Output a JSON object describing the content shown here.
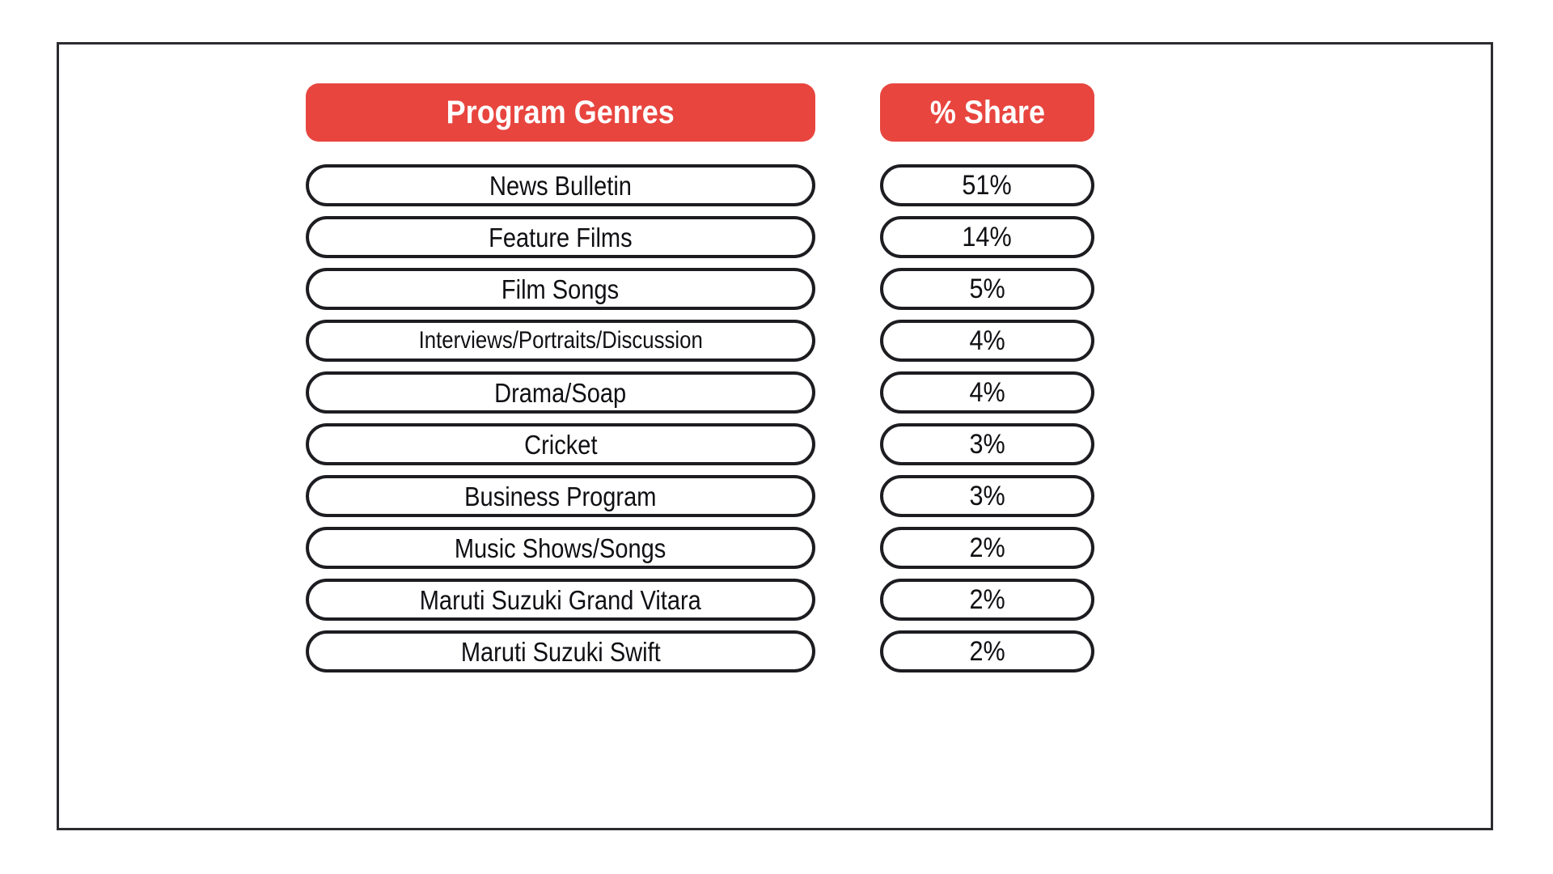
{
  "chart_data": {
    "type": "table",
    "title": "",
    "columns": [
      "Program Genres",
      "% Share"
    ],
    "categories": [
      "News Bulletin",
      "Feature Films",
      "Film Songs",
      "Interviews/Portraits/Discussion",
      "Drama/Soap",
      "Cricket",
      "Business Program",
      "Music Shows/Songs",
      "Maruti Suzuki Grand Vitara",
      "Maruti Suzuki Swift"
    ],
    "values": [
      51,
      14,
      5,
      4,
      4,
      3,
      3,
      2,
      2,
      2
    ],
    "value_labels": [
      "51%",
      "14%",
      "5%",
      "4%",
      "4%",
      "3%",
      "3%",
      "2%",
      "2%",
      "2%"
    ],
    "xlabel": "Program Genres",
    "ylabel": "% Share",
    "unit": "%",
    "legend": [],
    "grid": false
  },
  "table": {
    "header": {
      "genres": "Program Genres",
      "share": "% Share"
    },
    "rows": [
      {
        "genre": "News Bulletin",
        "share": "51%",
        "tight": false
      },
      {
        "genre": "Feature Films",
        "share": "14%",
        "tight": false
      },
      {
        "genre": "Film Songs",
        "share": "5%",
        "tight": false
      },
      {
        "genre": "Interviews/Portraits/Discussion",
        "share": "4%",
        "tight": true
      },
      {
        "genre": "Drama/Soap",
        "share": "4%",
        "tight": false
      },
      {
        "genre": "Cricket",
        "share": "3%",
        "tight": false
      },
      {
        "genre": "Business Program",
        "share": "3%",
        "tight": false
      },
      {
        "genre": "Music Shows/Songs",
        "share": "2%",
        "tight": false
      },
      {
        "genre": "Maruti Suzuki Grand Vitara",
        "share": "2%",
        "tight": false
      },
      {
        "genre": "Maruti Suzuki Swift",
        "share": "2%",
        "tight": false
      }
    ]
  },
  "colors": {
    "header_background": "#e8453f",
    "header_text": "#ffffff",
    "pill_border": "#1d1d21",
    "pill_background": "#ffffff",
    "pill_text": "#101014",
    "frame_border": "#2b2b30",
    "page_background": "#ffffff"
  }
}
